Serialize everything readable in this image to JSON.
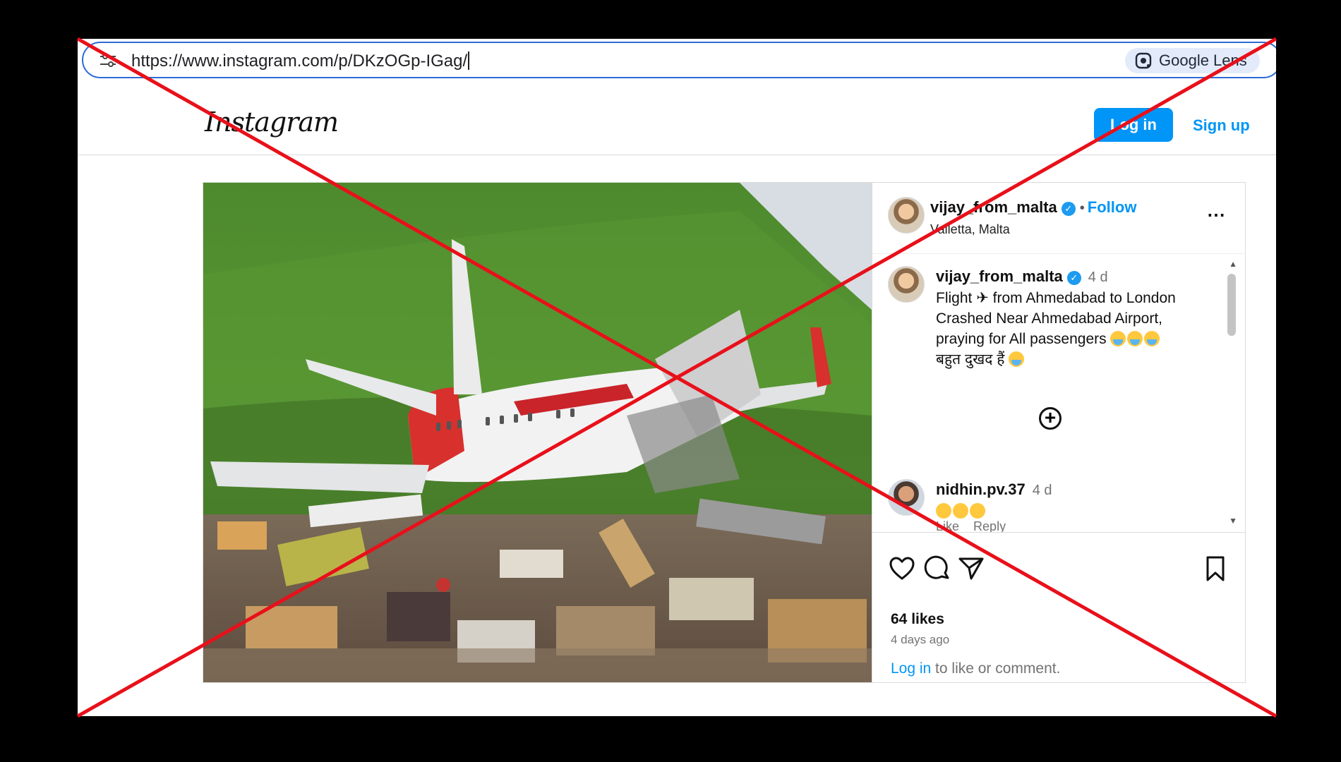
{
  "browser": {
    "url": "https://www.instagram.com/p/DKzOGp-IGag/",
    "lens_label": "Google Lens"
  },
  "header": {
    "logo": "Instagram",
    "login_label": "Log in",
    "signup_label": "Sign up"
  },
  "post": {
    "author": "vijay_from_malta",
    "follow_label": "Follow",
    "location": "Valletta, Malta",
    "caption_author": "vijay_from_malta",
    "caption_time": "4 d",
    "caption_line1": "Flight",
    "caption_line1b": "from Ahmedabad to London",
    "caption_line2": "Crashed Near Ahmedabad Airport,",
    "caption_line3": "praying for All passengers",
    "caption_line4": "बहुत दुखद हैं",
    "comment_author": "nidhin.pv.37",
    "comment_time": "4 d",
    "comment_like": "Like",
    "comment_reply": "Reply",
    "likes": "64 likes",
    "posted_ago": "4 days ago",
    "login_link": "Log in",
    "login_suffix": " to like or comment."
  },
  "colors": {
    "accent": "#0095f6",
    "cross": "#e8101a"
  }
}
